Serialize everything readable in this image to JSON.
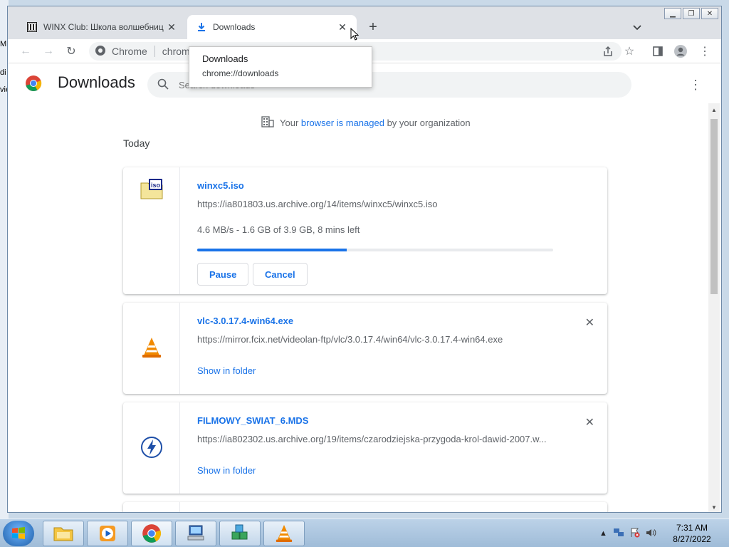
{
  "desktop": {
    "fragments": [
      "M",
      "di",
      "vie"
    ]
  },
  "tabs": [
    {
      "label": "WINX Club: Школа волшебниц",
      "icon": "archive-icon",
      "active": false
    },
    {
      "label": "Downloads",
      "icon": "download-icon",
      "active": true
    }
  ],
  "tooltip": {
    "title": "Downloads",
    "url": "chrome://downloads"
  },
  "omnibox": {
    "label": "Chrome",
    "text": "chrome://downloads"
  },
  "page": {
    "title": "Downloads",
    "search_placeholder": "Search downloads",
    "managed_prefix": "Your ",
    "managed_link": "browser is managed",
    "managed_suffix": " by your organization",
    "section_label": "Today"
  },
  "downloads": [
    {
      "filename": "winxc5.iso",
      "url": "https://ia801803.us.archive.org/14/items/winxc5/winxc5.iso",
      "status": "4.6 MB/s - 1.6 GB of 3.9 GB, 8 mins left",
      "progress_percent": 42,
      "pause_label": "Pause",
      "cancel_label": "Cancel",
      "icon": "iso-file-icon"
    },
    {
      "filename": "vlc-3.0.17.4-win64.exe",
      "url": "https://mirror.fcix.net/videolan-ftp/vlc/3.0.17.4/win64/vlc-3.0.17.4-win64.exe",
      "action_label": "Show in folder",
      "icon": "vlc-icon"
    },
    {
      "filename": "FILMOWY_SWIAT_6.MDS",
      "url": "https://ia802302.us.archive.org/19/items/czarodziejska-przygoda-krol-dawid-2007.w...",
      "action_label": "Show in folder",
      "icon": "daemon-tools-icon"
    }
  ],
  "clock": {
    "time": "7:31 AM",
    "date": "8/27/2022"
  },
  "colors": {
    "accent": "#1a73e8",
    "progress_track": "#e8eaed"
  }
}
